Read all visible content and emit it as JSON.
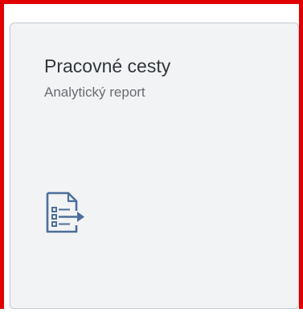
{
  "tile": {
    "title": "Pracovné cesty",
    "subtitle": "Analytický report",
    "icon": "report-list-export-icon"
  },
  "colors": {
    "highlight_border": "#e00000",
    "tile_background": "#f2f3f4",
    "icon_color": "#4c6e9a"
  }
}
